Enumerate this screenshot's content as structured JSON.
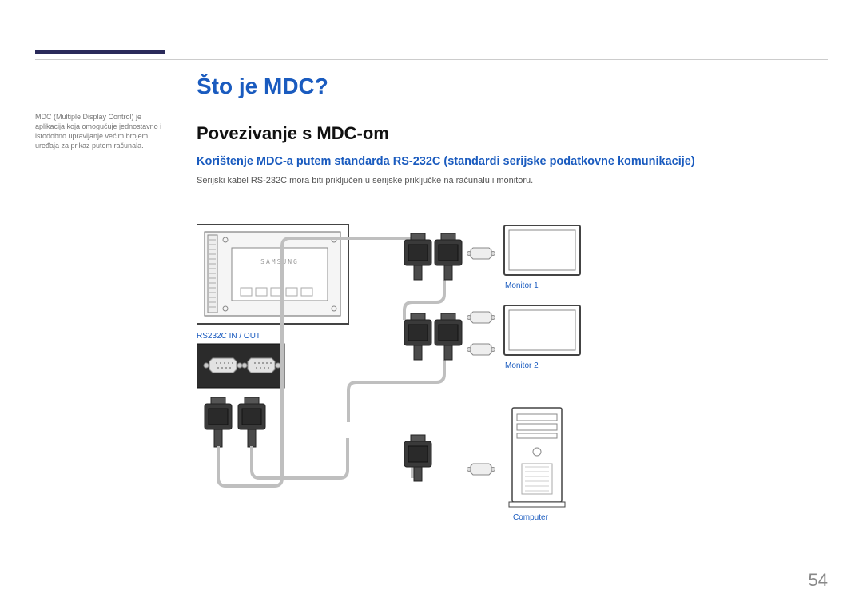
{
  "page_number": "54",
  "sidebar_note": "MDC (Multiple Display Control) je aplikacija koja omogućuje jednostavno i istodobno upravljanje većim brojem uređaja za prikaz putem računala.",
  "title": "Što je MDC?",
  "section_title": "Povezivanje s MDC-om",
  "subsection_title": "Korištenje MDC-a putem standarda RS-232C (standardi serijske podatkovne komunikacije)",
  "body_text": "Serijski kabel RS-232C mora biti priključen u serijske priključke na računalu i monitoru.",
  "diagram": {
    "port_panel_label": "RS232C IN / OUT",
    "monitor1_label": "Monitor 1",
    "monitor2_label": "Monitor 2",
    "computer_label": "Computer",
    "device_brand": "SAMSUNG"
  }
}
